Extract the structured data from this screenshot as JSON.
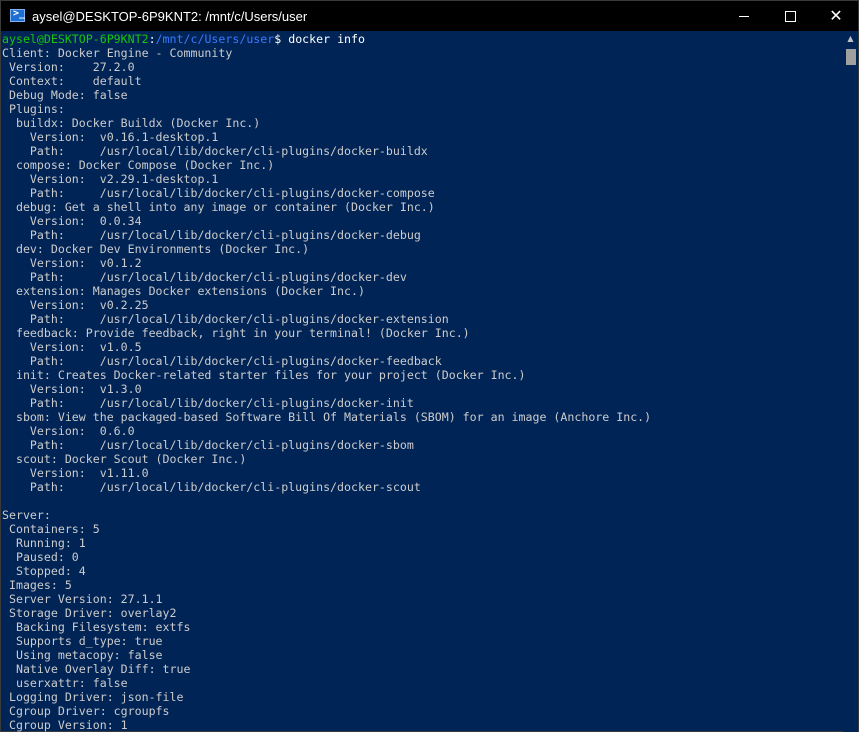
{
  "window": {
    "title": "aysel@DESKTOP-6P9KNT2: /mnt/c/Users/user"
  },
  "prompt": {
    "user_host": "aysel@DESKTOP-6P9KNT2",
    "sep": ":",
    "path": "/mnt/c/Users/user",
    "symbol": "$",
    "command": " docker info"
  },
  "output_lines": [
    "Client: Docker Engine - Community",
    " Version:    27.2.0",
    " Context:    default",
    " Debug Mode: false",
    " Plugins:",
    "  buildx: Docker Buildx (Docker Inc.)",
    "    Version:  v0.16.1-desktop.1",
    "    Path:     /usr/local/lib/docker/cli-plugins/docker-buildx",
    "  compose: Docker Compose (Docker Inc.)",
    "    Version:  v2.29.1-desktop.1",
    "    Path:     /usr/local/lib/docker/cli-plugins/docker-compose",
    "  debug: Get a shell into any image or container (Docker Inc.)",
    "    Version:  0.0.34",
    "    Path:     /usr/local/lib/docker/cli-plugins/docker-debug",
    "  dev: Docker Dev Environments (Docker Inc.)",
    "    Version:  v0.1.2",
    "    Path:     /usr/local/lib/docker/cli-plugins/docker-dev",
    "  extension: Manages Docker extensions (Docker Inc.)",
    "    Version:  v0.2.25",
    "    Path:     /usr/local/lib/docker/cli-plugins/docker-extension",
    "  feedback: Provide feedback, right in your terminal! (Docker Inc.)",
    "    Version:  v1.0.5",
    "    Path:     /usr/local/lib/docker/cli-plugins/docker-feedback",
    "  init: Creates Docker-related starter files for your project (Docker Inc.)",
    "    Version:  v1.3.0",
    "    Path:     /usr/local/lib/docker/cli-plugins/docker-init",
    "  sbom: View the packaged-based Software Bill Of Materials (SBOM) for an image (Anchore Inc.)",
    "    Version:  0.6.0",
    "    Path:     /usr/local/lib/docker/cli-plugins/docker-sbom",
    "  scout: Docker Scout (Docker Inc.)",
    "    Version:  v1.11.0",
    "    Path:     /usr/local/lib/docker/cli-plugins/docker-scout",
    "",
    "Server:",
    " Containers: 5",
    "  Running: 1",
    "  Paused: 0",
    "  Stopped: 4",
    " Images: 5",
    " Server Version: 27.1.1",
    " Storage Driver: overlay2",
    "  Backing Filesystem: extfs",
    "  Supports d_type: true",
    "  Using metacopy: false",
    "  Native Overlay Diff: true",
    "  userxattr: false",
    " Logging Driver: json-file",
    " Cgroup Driver: cgroupfs",
    " Cgroup Version: 1"
  ]
}
